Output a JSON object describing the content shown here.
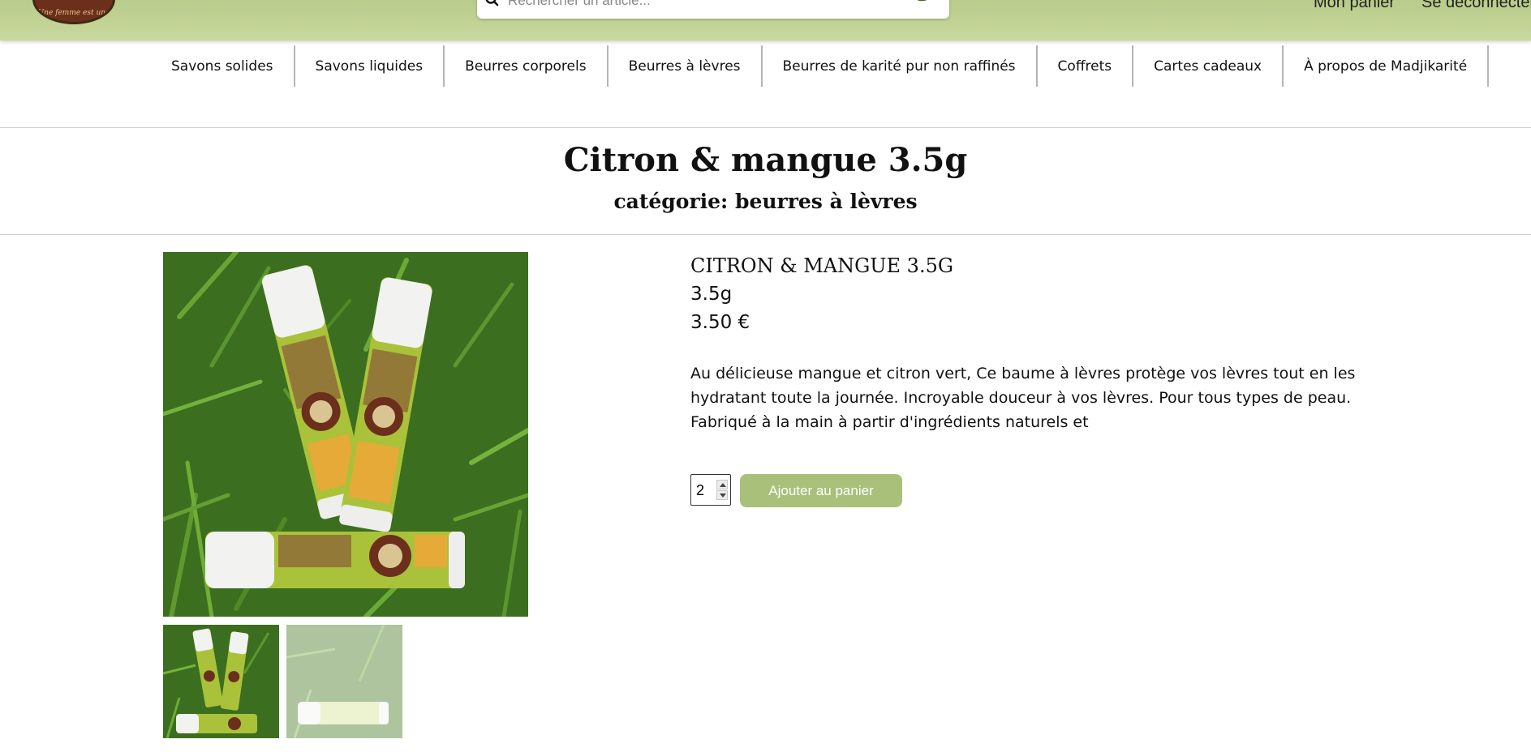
{
  "header": {
    "logo_text": "Une femme est une",
    "search_placeholder": "Rechercher un article...",
    "cart_label": "Mon panier",
    "logout_label": "Se déconnecter"
  },
  "nav": {
    "items": [
      {
        "label": "Savons solides"
      },
      {
        "label": "Savons liquides"
      },
      {
        "label": "Beurres corporels"
      },
      {
        "label": "Beurres à lèvres"
      },
      {
        "label": "Beurres de karité pur non raffinés"
      },
      {
        "label": "Coffrets"
      },
      {
        "label": "Cartes cadeaux"
      },
      {
        "label": "À propos de Madjikarité"
      }
    ]
  },
  "page": {
    "title": "Citron & mangue 3.5g",
    "subtitle": "catégorie: beurres à lèvres"
  },
  "product": {
    "name": "CITRON & MANGUE 3.5G",
    "weight": "3.5g",
    "price": "3.50 €",
    "description": "Au délicieuse mangue et citron vert, Ce baume à lèvres protège vos lèvres tout en les hydratant toute la journée. Incroyable douceur à vos lèvres. Pour tous types de peau. Fabriqué à la main à partir d'ingrédients naturels et",
    "quantity": "2",
    "add_to_cart_label": "Ajouter au panier"
  },
  "colors": {
    "header_bg": "#c2d494",
    "button_bg": "#a8c07a",
    "divider": "#b5b5b5"
  },
  "icons": {
    "search": "search-icon",
    "spin_up": "chevron-up-icon",
    "spin_down": "chevron-down-icon"
  }
}
